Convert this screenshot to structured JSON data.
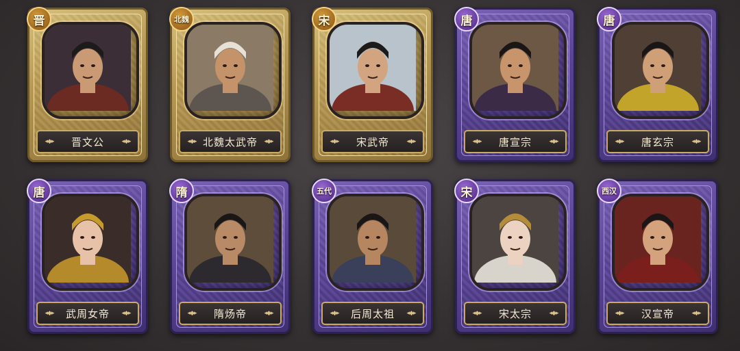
{
  "cards": [
    {
      "name": "晋文公",
      "dynasty": "晋",
      "frame": "gold",
      "robe": "#6b2a22",
      "bg": "#3c2e36",
      "skin": "#c99a74",
      "hat": "#1d1a1a"
    },
    {
      "name": "北魏太武帝",
      "dynasty": "北魏",
      "frame": "gold",
      "robe": "#5d5550",
      "bg": "#8a7a66",
      "skin": "#c4936a",
      "hat": "#e6e0d6"
    },
    {
      "name": "宋武帝",
      "dynasty": "宋",
      "frame": "gold",
      "robe": "#7a2d24",
      "bg": "#b9c3cb",
      "skin": "#d2a480",
      "hat": "#1d1a1a"
    },
    {
      "name": "唐宣宗",
      "dynasty": "唐",
      "frame": "purple",
      "robe": "#3b2b47",
      "bg": "#6d5845",
      "skin": "#c8946c",
      "hat": "#1a1616"
    },
    {
      "name": "唐玄宗",
      "dynasty": "唐",
      "frame": "purple",
      "robe": "#c2a42a",
      "bg": "#4f3f35",
      "skin": "#cf9f78",
      "hat": "#1a1616"
    },
    {
      "name": "武周女帝",
      "dynasty": "唐",
      "frame": "purple",
      "robe": "#b48a2a",
      "bg": "#3a2c28",
      "skin": "#e8c2a8",
      "hat": "#c79a2c"
    },
    {
      "name": "隋炀帝",
      "dynasty": "隋",
      "frame": "purple",
      "robe": "#2c2a2e",
      "bg": "#5d4d3a",
      "skin": "#b88a66",
      "hat": "#1a1616"
    },
    {
      "name": "后周太祖",
      "dynasty": "五代",
      "frame": "purple",
      "robe": "#3a3f5a",
      "bg": "#5a4a3a",
      "skin": "#b68660",
      "hat": "#1a1616"
    },
    {
      "name": "宋太宗",
      "dynasty": "宋",
      "frame": "purple",
      "robe": "#d8d4cc",
      "bg": "#4c4440",
      "skin": "#ecd2c0",
      "hat": "#b58c3a"
    },
    {
      "name": "汉宣帝",
      "dynasty": "西汉",
      "frame": "purple",
      "robe": "#7a1f1c",
      "bg": "#6a2420",
      "skin": "#d4a27c",
      "hat": "#1a1616"
    }
  ],
  "ornament": "◂◆▸"
}
